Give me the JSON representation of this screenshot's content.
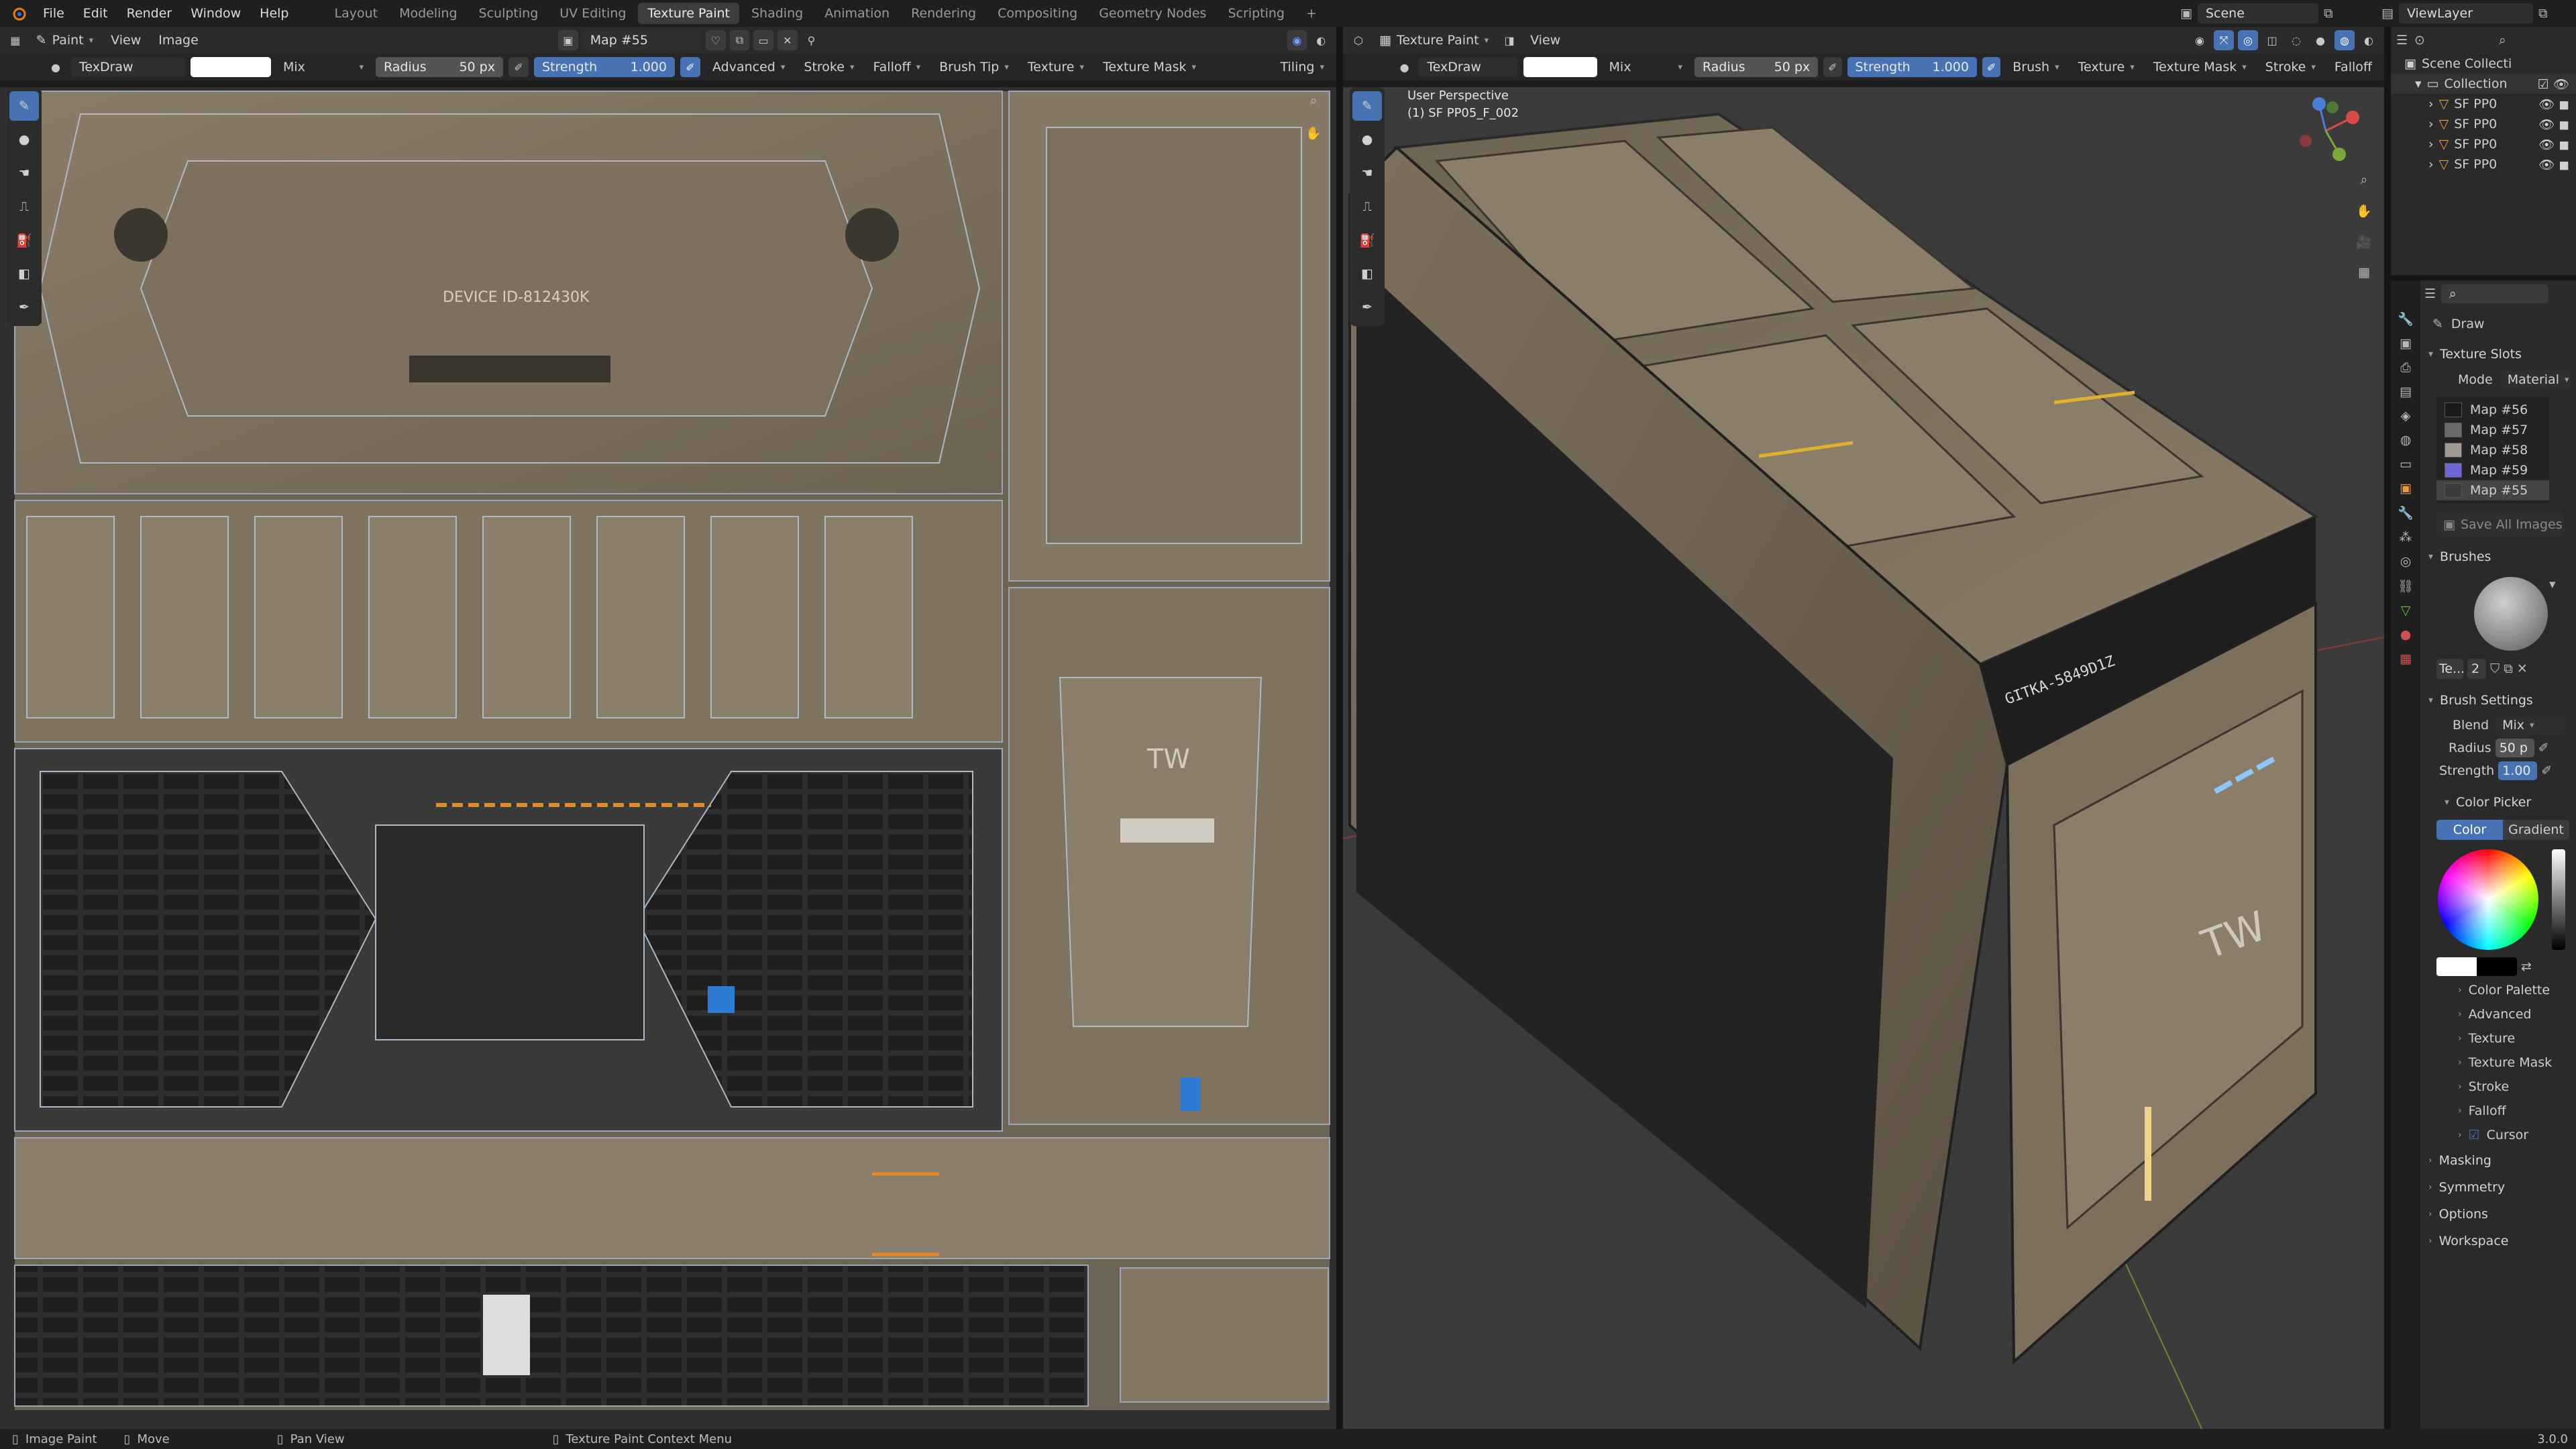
{
  "menu": {
    "file": "File",
    "edit": "Edit",
    "render": "Render",
    "window": "Window",
    "help": "Help"
  },
  "workspaces": [
    "Layout",
    "Modeling",
    "Sculpting",
    "UV Editing",
    "Texture Paint",
    "Shading",
    "Animation",
    "Rendering",
    "Compositing",
    "Geometry Nodes",
    "Scripting"
  ],
  "active_workspace": "Texture Paint",
  "scene": {
    "name": "Scene",
    "view_layer": "ViewLayer"
  },
  "image_editor": {
    "mode": "Paint",
    "view": "View",
    "image_menu": "Image",
    "image_name": "Map #55",
    "brush": "TexDraw",
    "blend": "Mix",
    "radius_label": "Radius",
    "radius_value": "50 px",
    "strength_label": "Strength",
    "strength_value": "1.000",
    "menus": [
      "Advanced",
      "Stroke",
      "Falloff",
      "Brush Tip",
      "Texture",
      "Texture Mask"
    ],
    "tiling": "Tiling",
    "uv_texts": {
      "device": "DEVICE ID-812430K",
      "tw": "TW"
    }
  },
  "viewport": {
    "mode": "Texture Paint",
    "view": "View",
    "brush": "TexDraw",
    "blend": "Mix",
    "radius_label": "Radius",
    "radius_value": "50 px",
    "strength_label": "Strength",
    "strength_value": "1.000",
    "menus": [
      "Brush",
      "Texture",
      "Texture Mask",
      "Stroke",
      "Falloff"
    ],
    "perspective": "User Perspective",
    "object": "(1) SF PP05_F_002",
    "model_texts": {
      "tw": "TW",
      "code": "GITKA-5849D1Z"
    }
  },
  "outliner": {
    "scene_collection": "Scene Collecti",
    "collection": "Collection",
    "items": [
      "SF PP0",
      "SF PP0",
      "SF PP0",
      "SF PP0"
    ]
  },
  "properties": {
    "tool": "Draw",
    "texture_slots": {
      "title": "Texture Slots",
      "mode_label": "Mode",
      "mode_value": "Material",
      "slots": [
        "Map #56",
        "Map #57",
        "Map #58",
        "Map #59",
        "Map #55"
      ],
      "slot_colors": [
        "#1a1a1a",
        "#6a6a6a",
        "#a09a90",
        "#6d67d6",
        "#3c3c3c"
      ],
      "save_all": "Save All Images"
    },
    "brushes": {
      "title": "Brushes",
      "name": "Te...",
      "users": "2"
    },
    "brush_settings": {
      "title": "Brush Settings",
      "blend_label": "Blend",
      "blend_value": "Mix",
      "radius_label": "Radius",
      "radius_value": "50 p",
      "strength_label": "Strength",
      "strength_value": "1.00"
    },
    "color_picker": {
      "title": "Color Picker",
      "color_tab": "Color",
      "gradient_tab": "Gradient"
    },
    "subpanels": [
      "Color Palette",
      "Advanced",
      "Texture",
      "Texture Mask",
      "Stroke",
      "Falloff",
      "Cursor"
    ],
    "sections": [
      "Masking",
      "Symmetry",
      "Options",
      "Workspace"
    ]
  },
  "statusbar": {
    "image_paint": "Image Paint",
    "move": "Move",
    "pan_view": "Pan View",
    "context": "Texture Paint Context Menu",
    "version": "3.0.0"
  },
  "colors": {
    "accent": "#4772b3",
    "header": "#2b2b2b",
    "bg": "#1d1d1d"
  }
}
